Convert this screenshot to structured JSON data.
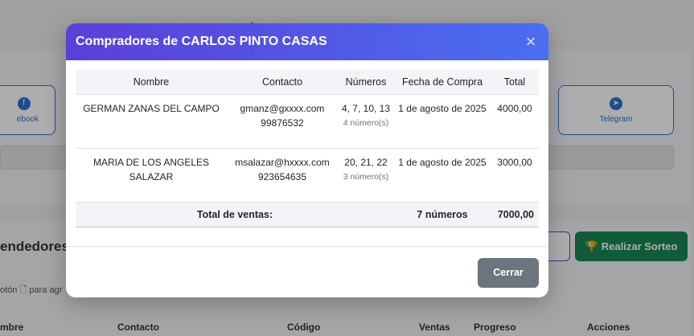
{
  "background": {
    "share_facebook": "ebook",
    "share_telegram": "Telegram",
    "section_title": "endedores",
    "hint_text": "otón",
    "hint_tail": "para agr",
    "realizar_sorteo": "Realizar Sorteo",
    "table_headers": [
      "mbre",
      "Contacto",
      "Código",
      "Ventas",
      "Progreso",
      "Acciones"
    ]
  },
  "modal": {
    "title": "Compradores de CARLOS PINTO CASAS",
    "close_symbol": "×",
    "columns": [
      "Nombre",
      "Contacto",
      "Números",
      "Fecha de Compra",
      "Total"
    ],
    "rows": [
      {
        "nombre": "GERMAN ZANAS DEL CAMPO",
        "email": "gmanz@gxxxx.com",
        "telefono": "99876532",
        "numeros": "4, 7, 10, 13",
        "cantidad": "4 número(s)",
        "fecha": "1 de agosto de 2025",
        "total": "4000,00"
      },
      {
        "nombre": "MARIA DE LOS ANGELES SALAZAR",
        "email": "msalazar@hxxxx.com",
        "telefono": "923654635",
        "numeros": "20, 21, 22",
        "cantidad": "3 número(s)",
        "fecha": "1 de agosto de 2025",
        "total": "3000,00"
      }
    ],
    "footer_label": "Total de ventas:",
    "footer_numeros": "7 números",
    "footer_total": "7000,00",
    "cerrar_label": "Cerrar"
  }
}
